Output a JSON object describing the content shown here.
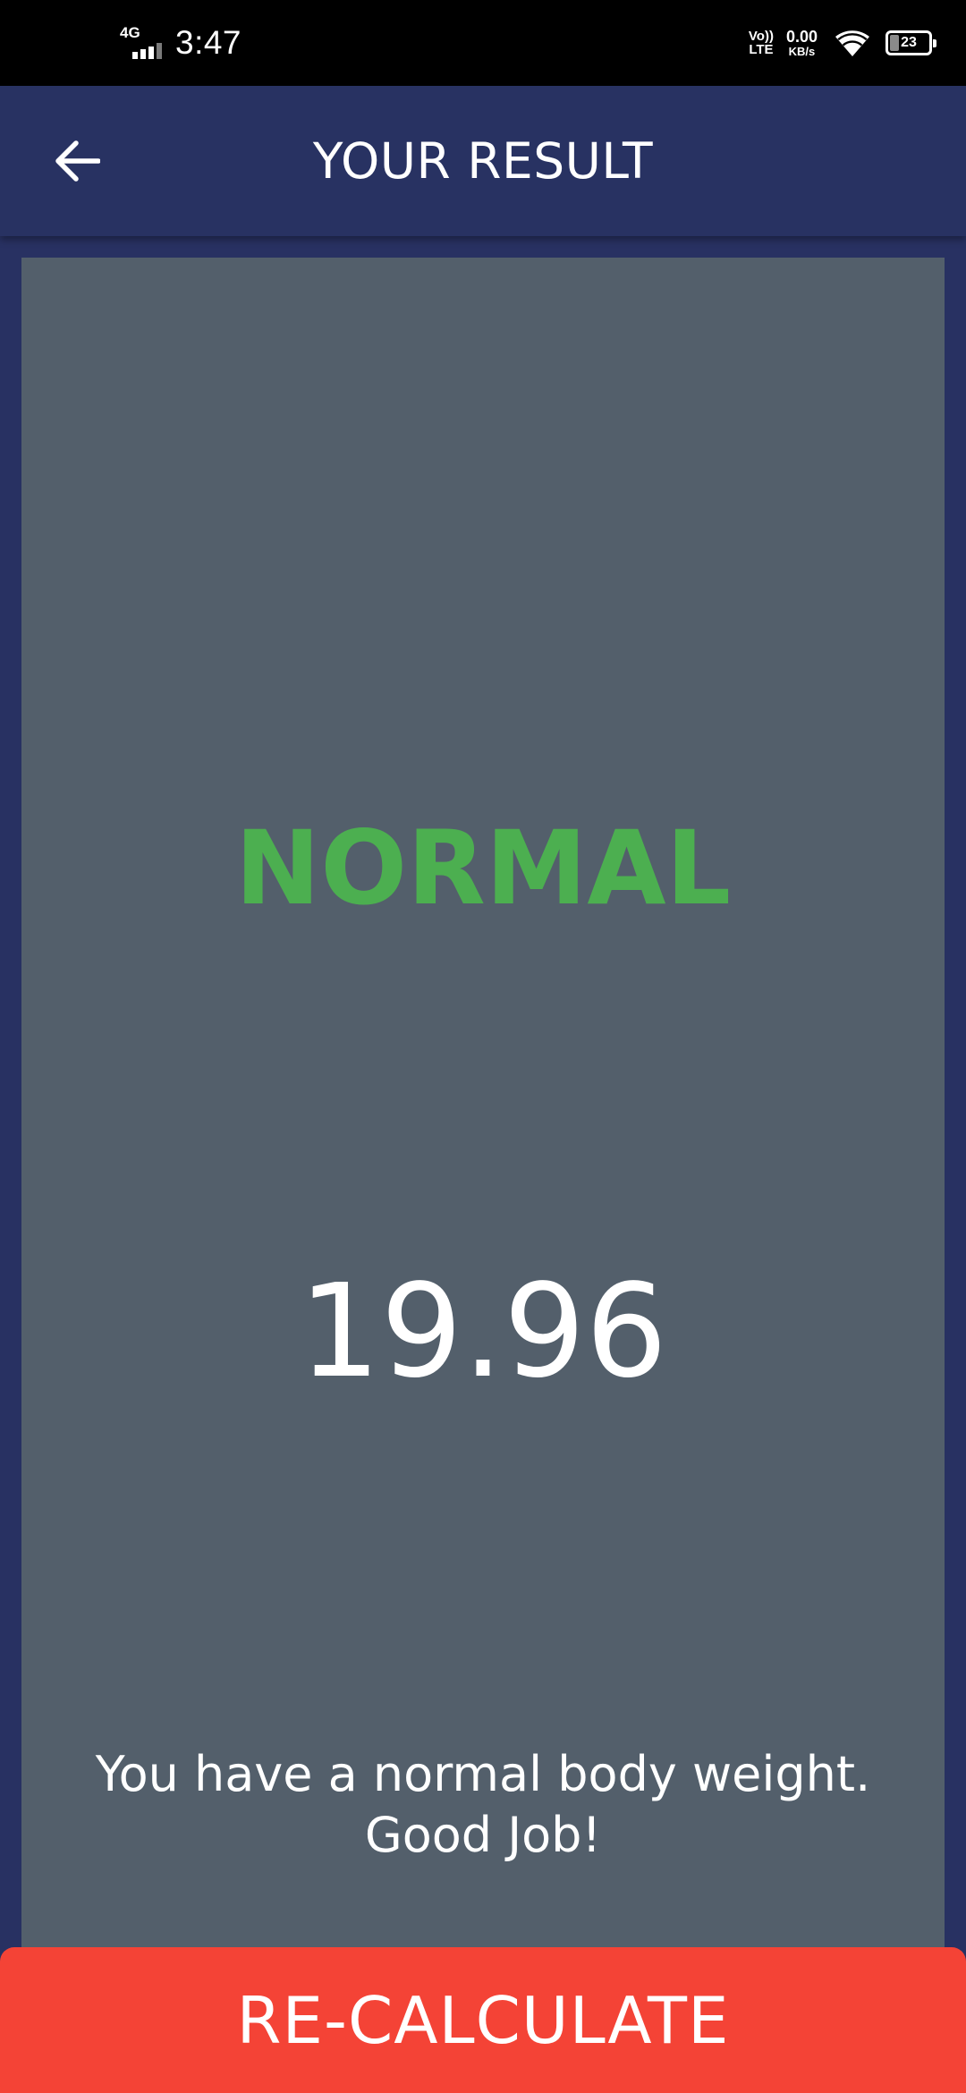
{
  "status_bar": {
    "network": "4G",
    "time": "3:47",
    "volte_top": "Vo))",
    "volte_bottom": "LTE",
    "speed_value": "0.00",
    "speed_unit": "KB/s",
    "battery_level": "23",
    "battery_fraction": 0.23
  },
  "app_bar": {
    "title": "YOUR RESULT",
    "back_icon": "arrow-back-icon"
  },
  "result": {
    "status": "NORMAL",
    "bmi": "19.96",
    "interpretation_line1": "You have a normal body weight.",
    "interpretation_line2": "Good Job!"
  },
  "actions": {
    "recalculate_label": "RE-CALCULATE"
  },
  "colors": {
    "status_bar_bg": "#000000",
    "app_bar_bg": "#283262",
    "page_bg": "#283162",
    "card_bg": "#535f6b",
    "status_normal": "#4caf50",
    "button_bg": "#f44336",
    "text_primary": "#ffffff"
  }
}
